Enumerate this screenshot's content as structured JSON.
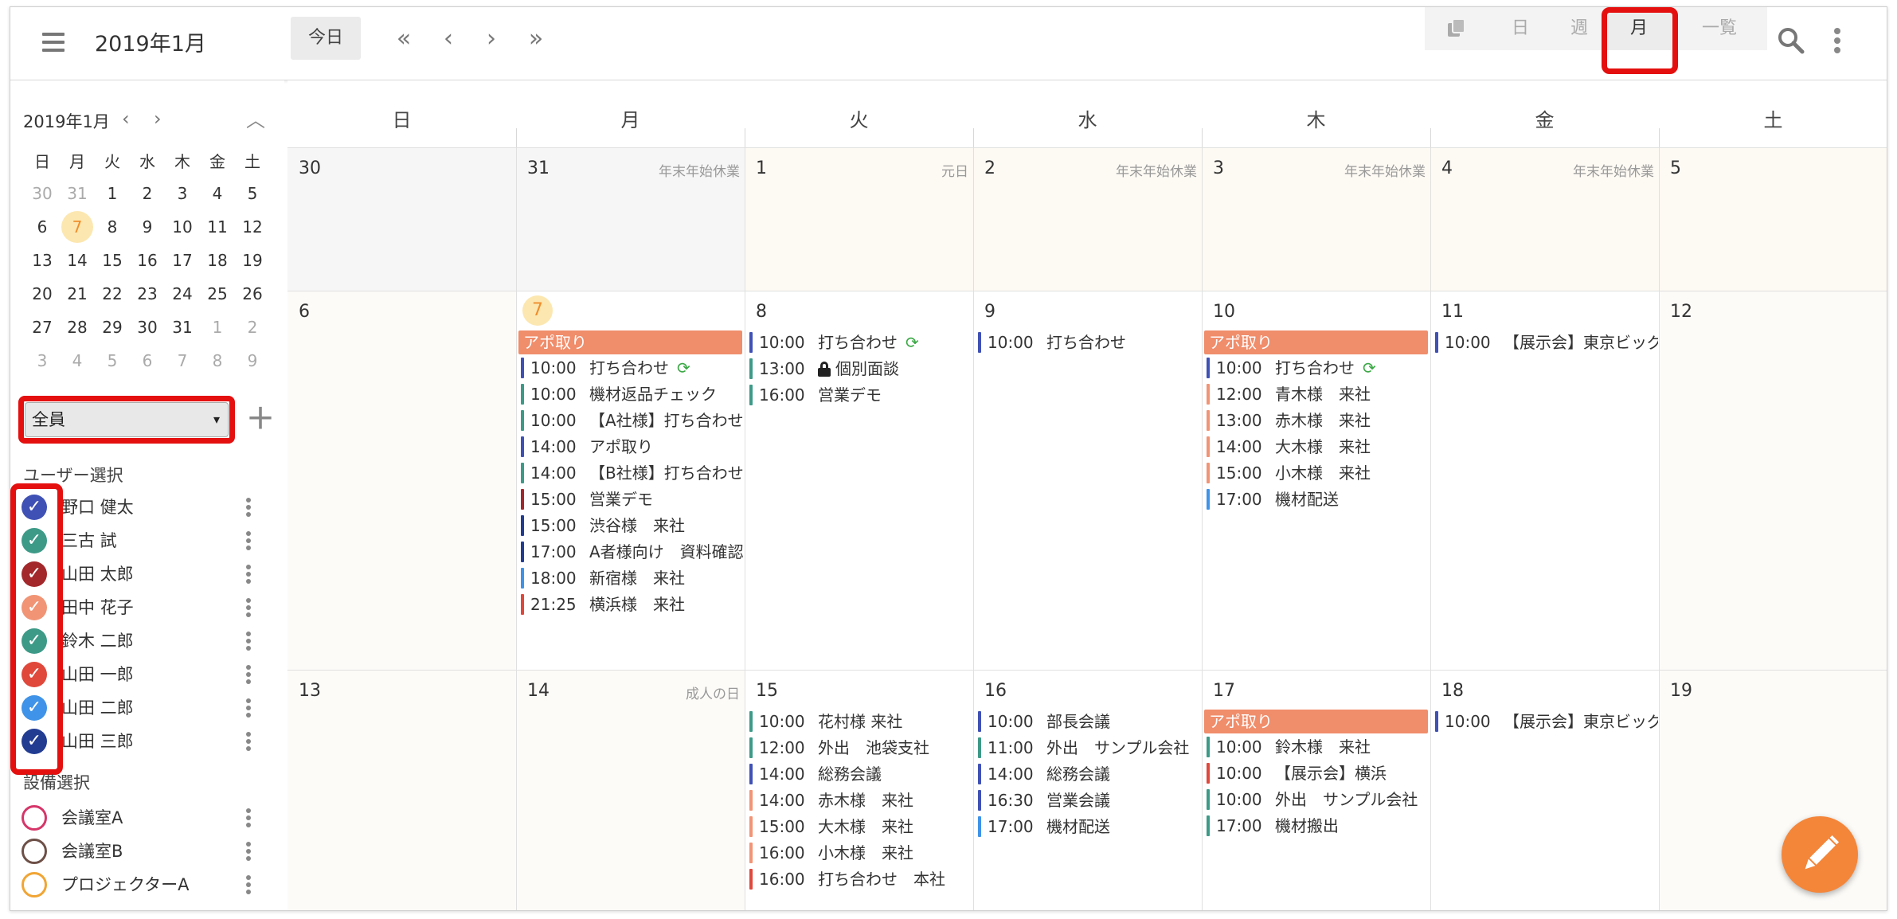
{
  "header": {
    "title": "2019年1月",
    "today_label": "今日",
    "nav": [
      "«",
      "‹",
      "›",
      "»"
    ],
    "views": [
      {
        "label": "",
        "icon": "copy-icon"
      },
      {
        "label": "日"
      },
      {
        "label": "週"
      },
      {
        "label": "月",
        "active": true
      },
      {
        "label": "一覧"
      }
    ]
  },
  "sidebar": {
    "mini_title": "2019年1月",
    "mini_dow": [
      "日",
      "月",
      "火",
      "水",
      "木",
      "金",
      "土"
    ],
    "mini_weeks": [
      [
        {
          "d": "30",
          "dim": true
        },
        {
          "d": "31",
          "dim": true
        },
        {
          "d": "1"
        },
        {
          "d": "2"
        },
        {
          "d": "3"
        },
        {
          "d": "4"
        },
        {
          "d": "5"
        }
      ],
      [
        {
          "d": "6"
        },
        {
          "d": "7",
          "today": true
        },
        {
          "d": "8"
        },
        {
          "d": "9"
        },
        {
          "d": "10"
        },
        {
          "d": "11"
        },
        {
          "d": "12"
        }
      ],
      [
        {
          "d": "13"
        },
        {
          "d": "14"
        },
        {
          "d": "15"
        },
        {
          "d": "16"
        },
        {
          "d": "17"
        },
        {
          "d": "18"
        },
        {
          "d": "19"
        }
      ],
      [
        {
          "d": "20"
        },
        {
          "d": "21"
        },
        {
          "d": "22"
        },
        {
          "d": "23"
        },
        {
          "d": "24"
        },
        {
          "d": "25"
        },
        {
          "d": "26"
        }
      ],
      [
        {
          "d": "27"
        },
        {
          "d": "28"
        },
        {
          "d": "29"
        },
        {
          "d": "30"
        },
        {
          "d": "31"
        },
        {
          "d": "1",
          "dim": true
        },
        {
          "d": "2",
          "dim": true
        }
      ],
      [
        {
          "d": "3",
          "dim": true
        },
        {
          "d": "4",
          "dim": true
        },
        {
          "d": "5",
          "dim": true
        },
        {
          "d": "6",
          "dim": true
        },
        {
          "d": "7",
          "dim": true
        },
        {
          "d": "8",
          "dim": true
        },
        {
          "d": "9",
          "dim": true
        }
      ]
    ],
    "user_filter": "全員",
    "user_section": "ユーザー選択",
    "users": [
      {
        "name": "野口 健太",
        "color": "#3f51b5"
      },
      {
        "name": "三古 試",
        "color": "#3d9a87"
      },
      {
        "name": "山田 太郎",
        "color": "#a3282b"
      },
      {
        "name": "田中 花子",
        "color": "#f19475"
      },
      {
        "name": "鈴木 二郎",
        "color": "#3d9a87"
      },
      {
        "name": "山田 一郎",
        "color": "#e0483c"
      },
      {
        "name": "山田 二郎",
        "color": "#3f93e8"
      },
      {
        "name": "山田 三郎",
        "color": "#223c92"
      }
    ],
    "equip_section": "設備選択",
    "equipment": [
      {
        "name": "会議室A",
        "color": "#d6366a"
      },
      {
        "name": "会議室B",
        "color": "#6d5047"
      },
      {
        "name": "プロジェクターA",
        "color": "#f1a534"
      }
    ]
  },
  "calendar": {
    "dow": [
      "日",
      "月",
      "火",
      "水",
      "木",
      "金",
      "土"
    ],
    "weeks": [
      [
        {
          "day": "30",
          "bg": "#f6f6f6"
        },
        {
          "day": "31",
          "bg": "#f6f6f6",
          "holiday": "年末年始休業"
        },
        {
          "day": "1",
          "bg": "#fdf9f3",
          "holiday": "元日"
        },
        {
          "day": "2",
          "bg": "#fdf9f3",
          "holiday": "年末年始休業"
        },
        {
          "day": "3",
          "bg": "#fdf9f3",
          "holiday": "年末年始休業"
        },
        {
          "day": "4",
          "bg": "#fdf9f3",
          "holiday": "年末年始休業"
        },
        {
          "day": "5",
          "bg": "#fdf9f3"
        }
      ],
      [
        {
          "day": "6",
          "bg": "#fdfbf8"
        },
        {
          "day": "7",
          "bg": "#ffffff",
          "today": true,
          "allday": "アポ取り",
          "events": [
            {
              "time": "10:00",
              "title": "打ち合わせ",
              "color": "#3f51b5",
              "sync": true
            },
            {
              "time": "10:00",
              "title": "機材返品チェック",
              "color": "#3d9a87"
            },
            {
              "time": "10:00",
              "title": "【A社様】打ち合わせ",
              "color": "#3d9a87"
            },
            {
              "time": "14:00",
              "title": "アポ取り",
              "color": "#3f51b5"
            },
            {
              "time": "14:00",
              "title": "【B社様】打ち合わせ",
              "color": "#3d9a87"
            },
            {
              "time": "15:00",
              "title": "営業デモ",
              "color": "#a3282b"
            },
            {
              "time": "15:00",
              "title": "渋谷様　来社",
              "color": "#223c92"
            },
            {
              "time": "17:00",
              "title": "A者様向け　資料確認",
              "color": "#223c92"
            },
            {
              "time": "18:00",
              "title": "新宿様　来社",
              "color": "#3f93e8"
            },
            {
              "time": "21:25",
              "title": "横浜様　来社",
              "color": "#e0483c"
            }
          ]
        },
        {
          "day": "8",
          "bg": "#ffffff",
          "events": [
            {
              "time": "10:00",
              "title": "打ち合わせ",
              "color": "#3f51b5",
              "sync": true
            },
            {
              "time": "13:00",
              "title": "個別面談",
              "color": "#3d9a87",
              "lock": true
            },
            {
              "time": "16:00",
              "title": "営業デモ",
              "color": "#3d9a87"
            }
          ]
        },
        {
          "day": "9",
          "bg": "#ffffff",
          "events": [
            {
              "time": "10:00",
              "title": "打ち合わせ",
              "color": "#3f51b5"
            }
          ]
        },
        {
          "day": "10",
          "bg": "#ffffff",
          "allday": "アポ取り",
          "events": [
            {
              "time": "10:00",
              "title": "打ち合わせ",
              "color": "#3f51b5",
              "sync": true
            },
            {
              "time": "12:00",
              "title": "青木様　来社",
              "color": "#f19475"
            },
            {
              "time": "13:00",
              "title": "赤木様　来社",
              "color": "#f19475"
            },
            {
              "time": "14:00",
              "title": "大木様　来社",
              "color": "#f19475"
            },
            {
              "time": "15:00",
              "title": "小木様　来社",
              "color": "#f19475"
            },
            {
              "time": "17:00",
              "title": "機材配送",
              "color": "#3f93e8"
            }
          ]
        },
        {
          "day": "11",
          "bg": "#ffffff",
          "events": [
            {
              "time": "10:00",
              "title": "【展示会】東京ビッグサイト",
              "color": "#3f51b5"
            }
          ]
        },
        {
          "day": "12",
          "bg": "#fdfbf8"
        }
      ],
      [
        {
          "day": "13",
          "bg": "#fdfbf8"
        },
        {
          "day": "14",
          "bg": "#fdfbf8",
          "holiday": "成人の日"
        },
        {
          "day": "15",
          "bg": "#ffffff",
          "events": [
            {
              "time": "10:00",
              "title": "花村様 来社",
              "color": "#3d9a87"
            },
            {
              "time": "12:00",
              "title": "外出　池袋支社",
              "color": "#3d9a87"
            },
            {
              "time": "14:00",
              "title": "総務会議",
              "color": "#3f51b5"
            },
            {
              "time": "14:00",
              "title": "赤木様　来社",
              "color": "#f19475"
            },
            {
              "time": "15:00",
              "title": "大木様　来社",
              "color": "#f19475"
            },
            {
              "time": "16:00",
              "title": "小木様　来社",
              "color": "#f19475"
            },
            {
              "time": "16:00",
              "title": "打ち合わせ　本社",
              "color": "#e0483c"
            }
          ]
        },
        {
          "day": "16",
          "bg": "#ffffff",
          "events": [
            {
              "time": "10:00",
              "title": "部長会議",
              "color": "#3f51b5"
            },
            {
              "time": "11:00",
              "title": "外出　サンプル会社",
              "color": "#3d9a87"
            },
            {
              "time": "14:00",
              "title": "総務会議",
              "color": "#3f51b5"
            },
            {
              "time": "16:30",
              "title": "営業会議",
              "color": "#3f51b5"
            },
            {
              "time": "17:00",
              "title": "機材配送",
              "color": "#3f93e8"
            }
          ]
        },
        {
          "day": "17",
          "bg": "#ffffff",
          "allday": "アポ取り",
          "events": [
            {
              "time": "10:00",
              "title": "鈴木様　来社",
              "color": "#3d9a87"
            },
            {
              "time": "10:00",
              "title": "【展示会】横浜",
              "color": "#e0483c"
            },
            {
              "time": "10:00",
              "title": "外出　サンプル会社",
              "color": "#3d9a87"
            },
            {
              "time": "17:00",
              "title": "機材搬出",
              "color": "#3d9a87"
            }
          ]
        },
        {
          "day": "18",
          "bg": "#ffffff",
          "events": [
            {
              "time": "10:00",
              "title": "【展示会】東京ビッグサイト",
              "color": "#3f51b5"
            }
          ]
        },
        {
          "day": "19",
          "bg": "#fdfbf8"
        }
      ]
    ]
  },
  "fab_icon": "pencil-icon"
}
